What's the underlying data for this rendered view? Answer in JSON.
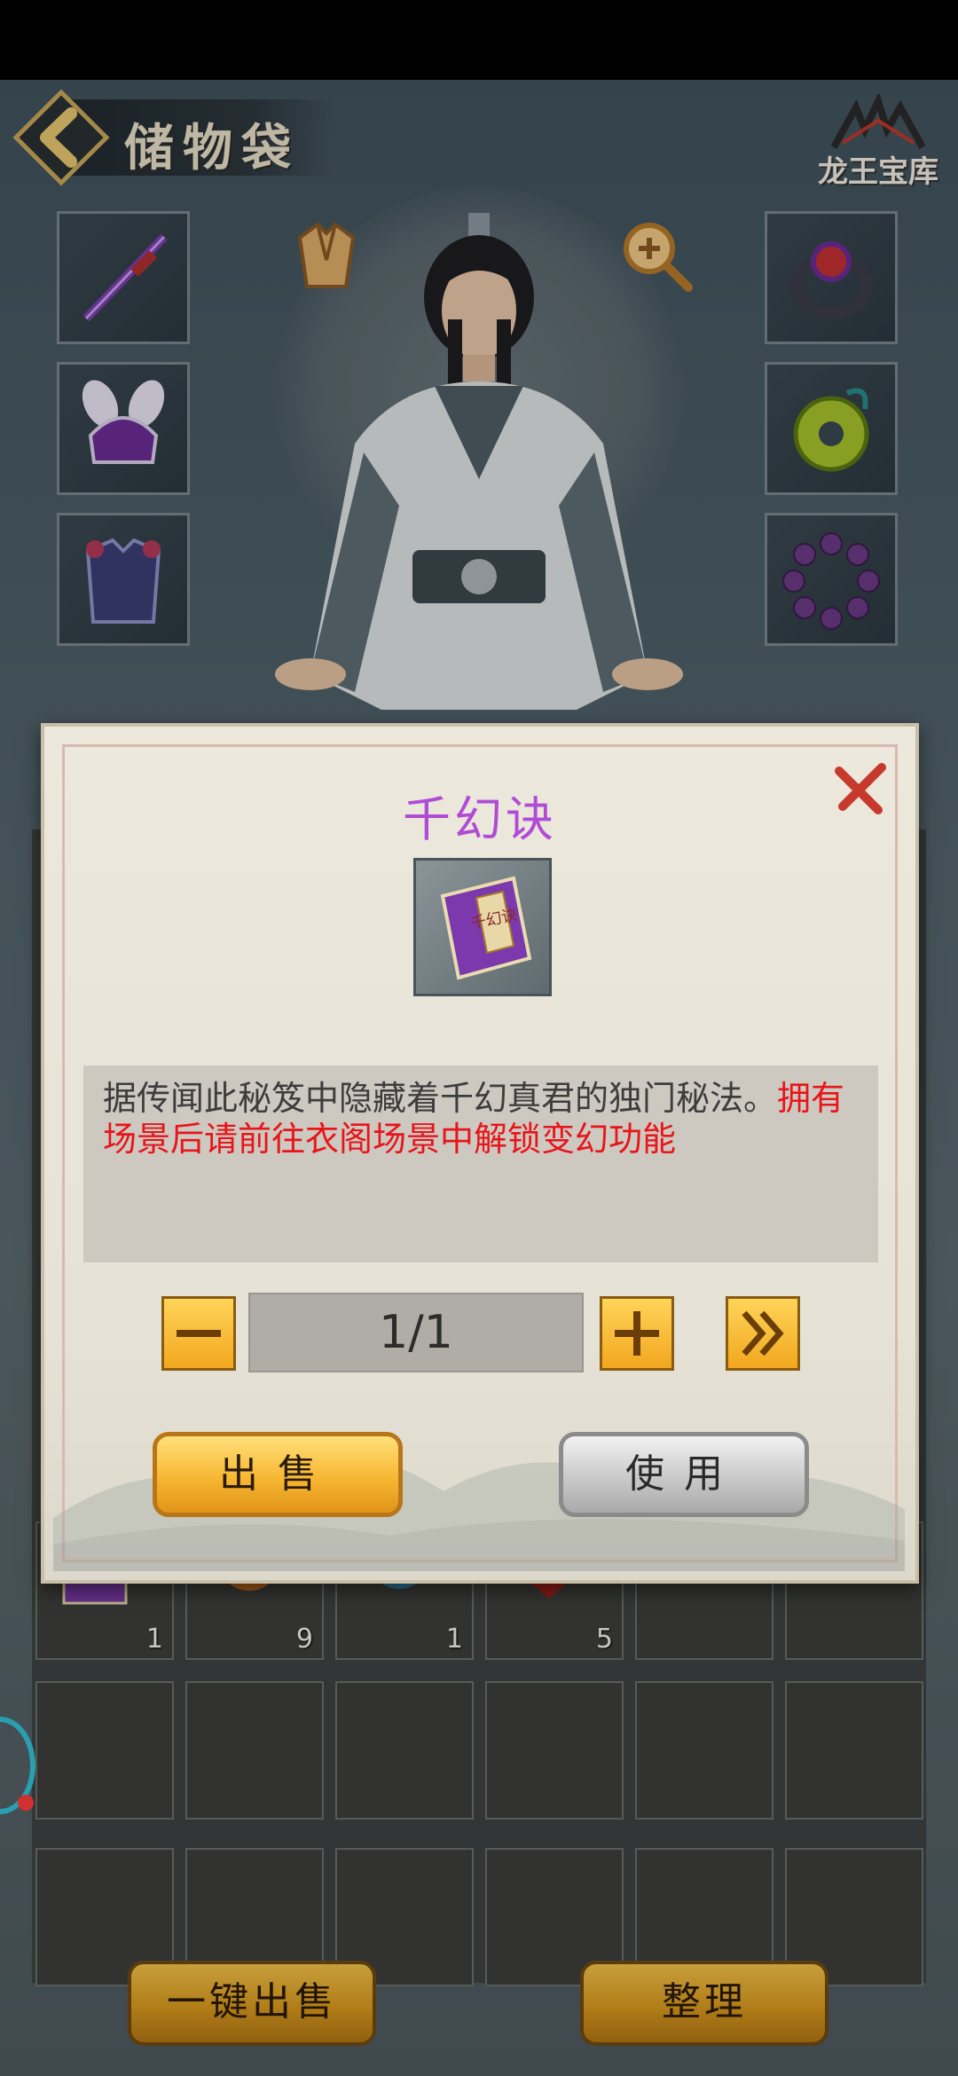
{
  "header": {
    "title": "储物袋",
    "treasure_label": "龙王宝库"
  },
  "equipment_slots": {
    "left": [
      "weapon-sword",
      "helmet",
      "armor"
    ],
    "right": [
      "ring",
      "jade-pendant",
      "bead-bracelet"
    ]
  },
  "bag": {
    "item_counts": [
      "1",
      "9",
      "1",
      "5"
    ]
  },
  "bottom": {
    "sell_all_label": "一键出售",
    "sort_label": "整理"
  },
  "dialog": {
    "title": "千幻诀",
    "book_label": "千幻诀",
    "description_normal": "据传闻此秘笈中隐藏着千幻真君的独门秘法。",
    "description_highlight": "拥有场景后请前往衣阁场景中解锁变幻功能",
    "quantity": "1/1",
    "sell_label": "出售",
    "use_label": "使用"
  },
  "colors": {
    "title_purple": "#b04bd6",
    "highlight_red": "#e8151b",
    "button_gold": "#f2a71e"
  }
}
